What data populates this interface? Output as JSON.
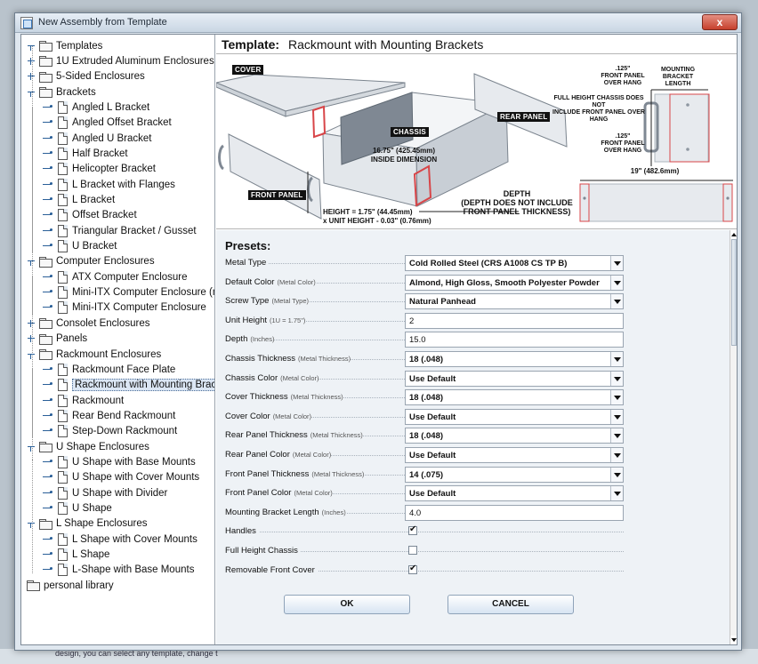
{
  "window": {
    "title": "New Assembly from Template",
    "close_glyph": "x"
  },
  "tree": {
    "rows": [
      {
        "level": 0,
        "type": "folder",
        "state": "expanded",
        "label": "Templates"
      },
      {
        "level": 1,
        "type": "folder",
        "state": "collapsed",
        "label": "1U Extruded Aluminum Enclosures"
      },
      {
        "level": 1,
        "type": "folder",
        "state": "collapsed",
        "label": "5-Sided Enclosures"
      },
      {
        "level": 1,
        "type": "folder",
        "state": "expanded",
        "label": "Brackets"
      },
      {
        "level": 2,
        "type": "leaf",
        "label": "Angled L Bracket"
      },
      {
        "level": 2,
        "type": "leaf",
        "label": "Angled Offset Bracket"
      },
      {
        "level": 2,
        "type": "leaf",
        "label": "Angled U Bracket"
      },
      {
        "level": 2,
        "type": "leaf",
        "label": "Half Bracket"
      },
      {
        "level": 2,
        "type": "leaf",
        "label": "Helicopter Bracket"
      },
      {
        "level": 2,
        "type": "leaf",
        "label": "L Bracket with Flanges"
      },
      {
        "level": 2,
        "type": "leaf",
        "label": "L Bracket"
      },
      {
        "level": 2,
        "type": "leaf",
        "label": "Offset Bracket"
      },
      {
        "level": 2,
        "type": "leaf",
        "label": "Triangular Bracket / Gusset"
      },
      {
        "level": 2,
        "type": "leaf",
        "label": "U Bracket"
      },
      {
        "level": 1,
        "type": "folder",
        "state": "expanded",
        "label": "Computer Enclosures"
      },
      {
        "level": 2,
        "type": "leaf",
        "label": "ATX Computer Enclosure"
      },
      {
        "level": 2,
        "type": "leaf",
        "label": "Mini-ITX Computer Enclosure (no F"
      },
      {
        "level": 2,
        "type": "leaf",
        "label": "Mini-ITX Computer Enclosure"
      },
      {
        "level": 1,
        "type": "folder",
        "state": "collapsed",
        "label": "Consolet Enclosures"
      },
      {
        "level": 1,
        "type": "folder",
        "state": "collapsed",
        "label": "Panels"
      },
      {
        "level": 1,
        "type": "folder",
        "state": "expanded",
        "label": "Rackmount Enclosures"
      },
      {
        "level": 2,
        "type": "leaf",
        "label": "Rackmount Face Plate"
      },
      {
        "level": 2,
        "type": "leaf",
        "label": "Rackmount with Mounting Brackets",
        "selected": true
      },
      {
        "level": 2,
        "type": "leaf",
        "label": "Rackmount"
      },
      {
        "level": 2,
        "type": "leaf",
        "label": "Rear Bend Rackmount"
      },
      {
        "level": 2,
        "type": "leaf",
        "label": "Step-Down Rackmount"
      },
      {
        "level": 1,
        "type": "folder",
        "state": "expanded",
        "label": "U Shape Enclosures"
      },
      {
        "level": 2,
        "type": "leaf",
        "label": "U Shape with Base Mounts"
      },
      {
        "level": 2,
        "type": "leaf",
        "label": "U Shape with Cover Mounts"
      },
      {
        "level": 2,
        "type": "leaf",
        "label": "U Shape with Divider"
      },
      {
        "level": 2,
        "type": "leaf",
        "label": "U Shape"
      },
      {
        "level": 1,
        "type": "folder",
        "state": "expanded",
        "label": "L Shape Enclosures"
      },
      {
        "level": 2,
        "type": "leaf",
        "label": "L Shape with Cover Mounts"
      },
      {
        "level": 2,
        "type": "leaf",
        "label": "L Shape"
      },
      {
        "level": 2,
        "type": "leaf",
        "label": "L-Shape with Base Mounts"
      },
      {
        "level": 0,
        "type": "folder",
        "state": "none",
        "label": "personal library"
      }
    ]
  },
  "template": {
    "prefix": "Template:",
    "name": "Rackmount with Mounting Brackets"
  },
  "illustration": {
    "labels": {
      "cover": "COVER",
      "chassis": "CHASSIS",
      "rear_panel": "REAR PANEL",
      "front_panel": "FRONT PANEL"
    },
    "notes": {
      "inside_dimension": "16.75\" (425.45mm)\nINSIDE DIMENSION",
      "height": "HEIGHT = 1.75\" (44.45mm)\nx UNIT HEIGHT - 0.03\" (0.76mm)",
      "depth": "DEPTH\n(DEPTH DOES NOT INCLUDE\nFRONT PANEL THICKNESS)",
      "front_panel_overhang_top": ".125\"\nFRONT PANEL\nOVER HANG",
      "mounting_bracket_length": "MOUNTING\nBRACKET\nLENGTH",
      "full_height_chassis": "FULL HEIGHT CHASSIS DOES NOT\nINCLUDE FRONT PANEL OVER HANG",
      "front_panel_overhang_bottom": ".125\"\nFRONT PANEL\nOVER HANG",
      "rack_width": "19\" (482.6mm)"
    },
    "colors": {
      "panel_fill": "#e7eaee",
      "panel_stroke": "#7b848e",
      "accent_red": "#d84548"
    }
  },
  "presets": {
    "title": "Presets:",
    "fields": [
      {
        "label": "Metal Type",
        "sub": "",
        "kind": "select",
        "value": "Cold Rolled Steel (CRS A1008 CS TP B)"
      },
      {
        "label": "Default Color",
        "sub": "(Metal Color)",
        "kind": "select",
        "value": "Almond, High Gloss, Smooth Polyester Powder"
      },
      {
        "label": "Screw Type",
        "sub": "(Metal Type)",
        "kind": "select",
        "value": "Natural Panhead"
      },
      {
        "label": "Unit Height",
        "sub": "(1U = 1.75\")",
        "kind": "text",
        "value": "2"
      },
      {
        "label": "Depth",
        "sub": "(Inches)",
        "kind": "text",
        "value": "15.0"
      },
      {
        "label": "Chassis Thickness",
        "sub": "(Metal Thickness)",
        "kind": "select",
        "value": "18 (.048)"
      },
      {
        "label": "Chassis Color",
        "sub": "(Metal Color)",
        "kind": "select",
        "value": "Use Default"
      },
      {
        "label": "Cover Thickness",
        "sub": "(Metal Thickness)",
        "kind": "select",
        "value": "18 (.048)"
      },
      {
        "label": "Cover Color",
        "sub": "(Metal Color)",
        "kind": "select",
        "value": "Use Default"
      },
      {
        "label": "Rear Panel Thickness",
        "sub": "(Metal Thickness)",
        "kind": "select",
        "value": "18 (.048)"
      },
      {
        "label": "Rear Panel Color",
        "sub": "(Metal Color)",
        "kind": "select",
        "value": "Use Default"
      },
      {
        "label": "Front Panel Thickness",
        "sub": "(Metal Thickness)",
        "kind": "select",
        "value": "14 (.075)"
      },
      {
        "label": "Front Panel Color",
        "sub": "(Metal Color)",
        "kind": "select",
        "value": "Use Default"
      },
      {
        "label": "Mounting Bracket Length",
        "sub": "(Inches)",
        "kind": "text",
        "value": "4.0"
      },
      {
        "label": "Handles",
        "sub": "",
        "kind": "checkbox",
        "checked": true
      },
      {
        "label": "Full Height Chassis",
        "sub": "",
        "kind": "checkbox",
        "checked": false
      },
      {
        "label": "Removable Front Cover",
        "sub": "",
        "kind": "checkbox",
        "checked": true
      }
    ],
    "check_glyph": "✔"
  },
  "buttons": {
    "ok": "OK",
    "cancel": "CANCEL"
  },
  "background_text": "design, you can select any template, change t"
}
